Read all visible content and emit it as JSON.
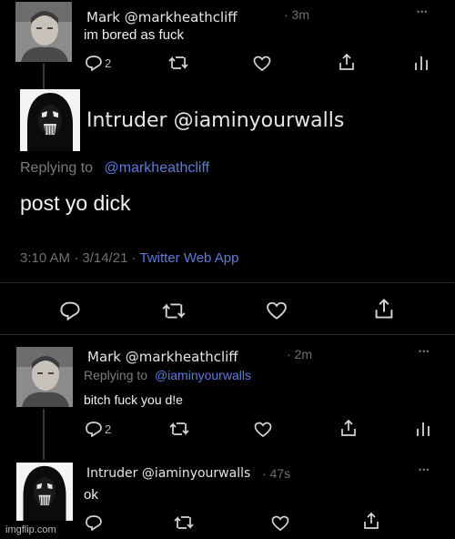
{
  "tweet1": {
    "author": "Mark @markheathcliff",
    "time": "· 3m",
    "text": "im bored as fuck",
    "reply_count": "2",
    "more": "•••"
  },
  "tweet2": {
    "author": "Intruder @iaminyourwalls",
    "replying_to": "Replying to",
    "mention": "@markheathcliff",
    "text": "post yo dick",
    "timestamp": "3:10 AM · 3/14/21 · ",
    "client": "Twitter Web App"
  },
  "tweet3": {
    "author": "Mark @markheathcliff",
    "time": "· 2m",
    "replying_to": "Replying to",
    "mention": "@iaminyourwalls",
    "text": "bitch fuck you d!e",
    "reply_count": "2",
    "more": "•••"
  },
  "tweet4": {
    "author": "Intruder @iaminyourwalls",
    "time": "· 47s",
    "text": "ok",
    "more": "•••"
  },
  "watermark": "imgflip.com",
  "colors": {
    "background": "#000000",
    "mention": "#5d7bd8",
    "meta": "#6f6f6f"
  }
}
